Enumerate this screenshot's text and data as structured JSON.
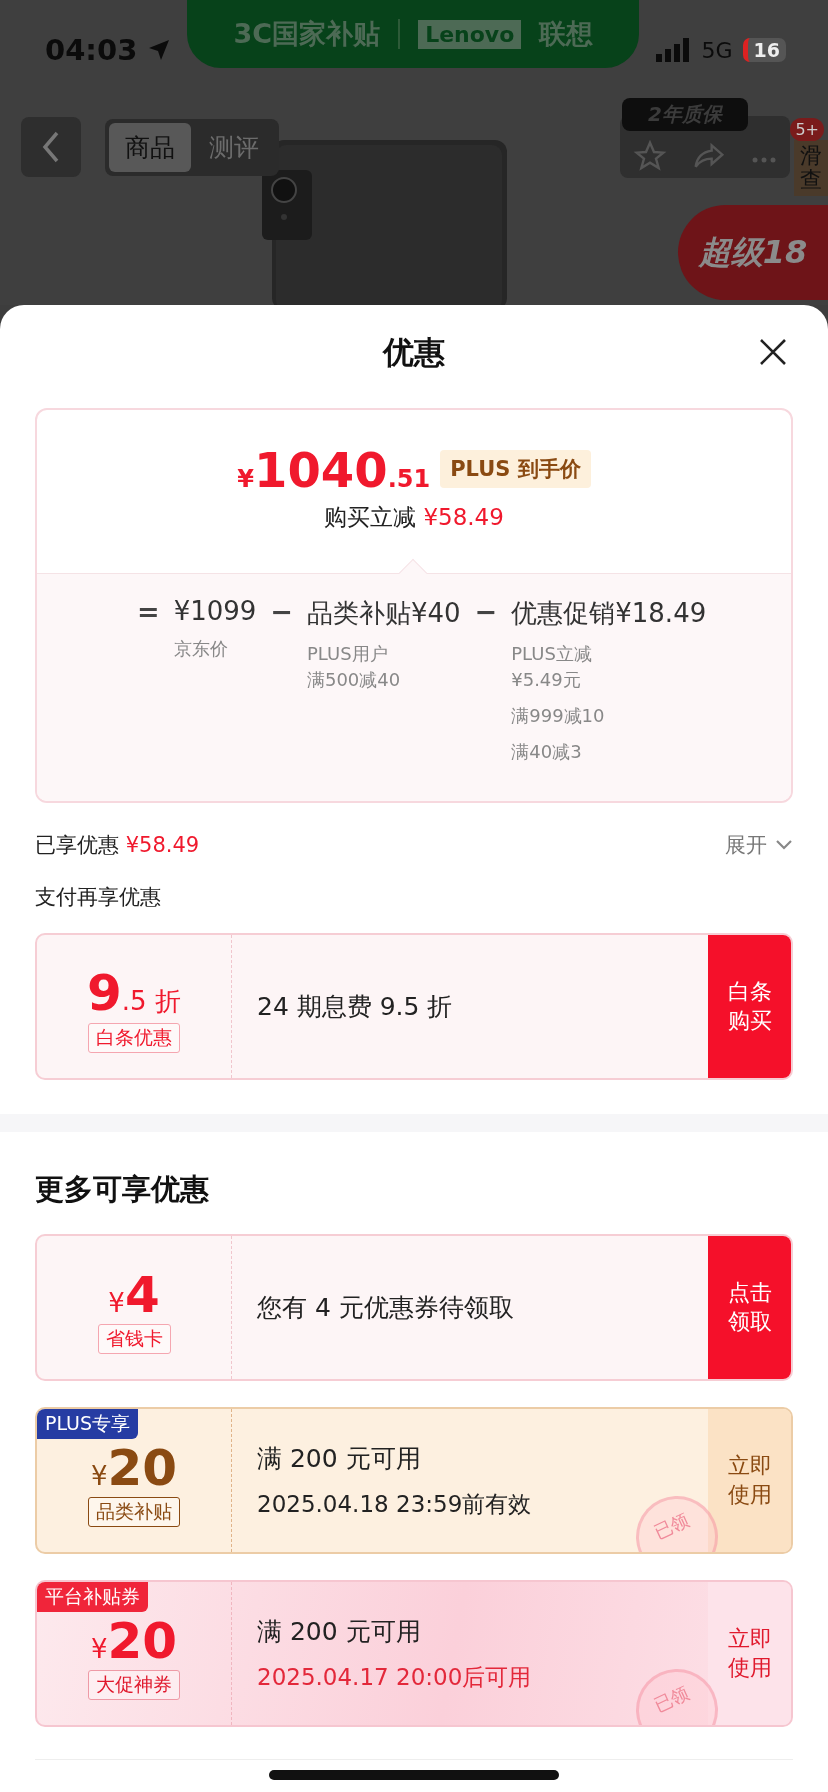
{
  "status_bar": {
    "time": "04:03",
    "network": "5G",
    "battery": "16"
  },
  "banner": {
    "title": "3C国家补贴",
    "brand_badge": "Lenovo",
    "brand_name": "联想"
  },
  "product_page": {
    "tabs": [
      {
        "label": "商品",
        "selected": true
      },
      {
        "label": "测评",
        "selected": false
      }
    ],
    "warranty_badge": "2年质保",
    "notification_count": "5+",
    "side_hint": "滑查",
    "promo_badge": "超级18"
  },
  "sheet": {
    "title": "优惠",
    "price": {
      "currency": "¥",
      "integer": "1040",
      "decimal": ".51",
      "tag": "PLUS 到手价",
      "saving_label": "购买立减",
      "saving_amount": "¥58.49"
    },
    "breakdown": [
      {
        "operator": "=",
        "amount": "¥1099",
        "notes": [
          [
            "京东价"
          ]
        ]
      },
      {
        "operator": "−",
        "label": "品类补贴",
        "amount": "¥40",
        "notes": [
          [
            "PLUS用户",
            "满500减40"
          ]
        ]
      },
      {
        "operator": "−",
        "label": "优惠促销",
        "amount": "¥18.49",
        "notes": [
          [
            "PLUS立减",
            "¥5.49元"
          ],
          [
            "满999减10"
          ],
          [
            "满40减3"
          ]
        ]
      }
    ],
    "enjoyed": {
      "label": "已享优惠",
      "amount": "¥58.49",
      "toggle": "展开",
      "expanded": false
    },
    "payment_section": {
      "title": "支付再享优惠",
      "offers": [
        {
          "kind": "discount",
          "value": "9",
          "suffix": ".5 折",
          "tag": "白条优惠",
          "description": "24 期息费 9.5 折",
          "action": "白条购买"
        }
      ]
    },
    "more_section": {
      "title": "更多可享优惠",
      "offers": [
        {
          "kind": "claim",
          "currency": "¥",
          "value": "4",
          "tag": "省钱卡",
          "description": "您有 4 元优惠券待领取",
          "action": "点击领取"
        },
        {
          "kind": "plus_coupon",
          "corner_label": "PLUS专享",
          "currency": "¥",
          "value": "20",
          "tag": "品类补贴",
          "condition": "满 200 元可用",
          "validity": "2025.04.18 23:59前有效",
          "action": "立即使用",
          "stamp": "已领"
        },
        {
          "kind": "platform_coupon",
          "corner_label": "平台补贴券",
          "currency": "¥",
          "value": "20",
          "tag": "大促神券",
          "condition": "满 200 元可用",
          "validity": "2025.04.17 20:00后可用",
          "action": "立即使用",
          "stamp": "已领"
        }
      ]
    }
  }
}
